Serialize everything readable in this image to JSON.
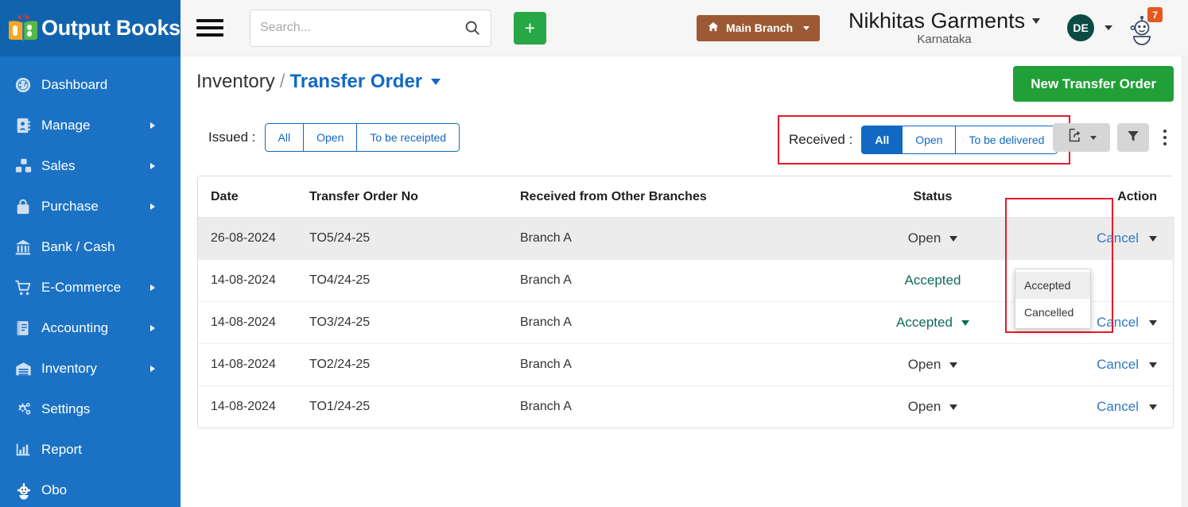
{
  "sidebar": {
    "brand": "Output Books",
    "logo_icon": "open-book-logo",
    "items": [
      {
        "label": "Dashboard",
        "icon": "dashboard-icon",
        "caret": false
      },
      {
        "label": "Manage",
        "icon": "contacts-icon",
        "caret": true
      },
      {
        "label": "Sales",
        "icon": "boxes-icon",
        "caret": true
      },
      {
        "label": "Purchase",
        "icon": "bag-icon",
        "caret": true
      },
      {
        "label": "Bank / Cash",
        "icon": "bank-icon",
        "caret": false
      },
      {
        "label": "E-Commerce",
        "icon": "cart-icon",
        "caret": true
      },
      {
        "label": "Accounting",
        "icon": "book-icon",
        "caret": true
      },
      {
        "label": "Inventory",
        "icon": "warehouse-icon",
        "caret": true
      },
      {
        "label": "Settings",
        "icon": "gears-icon",
        "caret": false
      },
      {
        "label": "Report",
        "icon": "bar-chart-icon",
        "caret": false
      },
      {
        "label": "Obo",
        "icon": "bot-icon",
        "caret": false
      }
    ]
  },
  "topbar": {
    "menu_icon": "hamburger-icon",
    "search": {
      "value": "",
      "placeholder": "Search...",
      "icon": "search-icon"
    },
    "add_button_label": "+",
    "branch": {
      "label": "Main Branch",
      "icon": "home-icon"
    },
    "company": {
      "name": "Nikhitas Garments",
      "state": "Karnataka"
    },
    "avatar": {
      "initials": "DE",
      "color": "#0b4b44"
    },
    "bot": {
      "icon": "robot-icon",
      "badge": "7",
      "badge_color": "#e8571f"
    }
  },
  "page": {
    "breadcrumb": {
      "parent": "Inventory",
      "separator": "/",
      "current": "Transfer Order"
    },
    "new_button_label": "New Transfer Order"
  },
  "filters": {
    "issued": {
      "label": "Issued :",
      "options": [
        "All",
        "Open",
        "To be receipted"
      ],
      "selected": null
    },
    "received": {
      "label": "Received :",
      "options": [
        "All",
        "Open",
        "To be delivered"
      ],
      "selected": "All",
      "highlighted": true
    },
    "tools": {
      "export_icon": "share-export-icon",
      "filter_icon": "funnel-icon",
      "more_icon": "kebab-menu-icon"
    }
  },
  "table": {
    "columns": [
      "Date",
      "Transfer Order No",
      "Received from Other Branches",
      "Status",
      "Action"
    ],
    "rows": [
      {
        "date": "26-08-2024",
        "order_no": "TO5/24-25",
        "branch": "Branch A",
        "status": "Open",
        "status_style": "default",
        "action": "Cancel",
        "highlighted": true
      },
      {
        "date": "14-08-2024",
        "order_no": "TO4/24-25",
        "branch": "Branch A",
        "status": "Accepted",
        "status_style": "accepted",
        "action": "",
        "highlighted": false
      },
      {
        "date": "14-08-2024",
        "order_no": "TO3/24-25",
        "branch": "Branch A",
        "status": "Accepted",
        "status_style": "accepted",
        "action": "Cancel",
        "highlighted": false
      },
      {
        "date": "14-08-2024",
        "order_no": "TO2/24-25",
        "branch": "Branch A",
        "status": "Open",
        "status_style": "default",
        "action": "Cancel",
        "highlighted": false
      },
      {
        "date": "14-08-2024",
        "order_no": "TO1/24-25",
        "branch": "Branch A",
        "status": "Open",
        "status_style": "default",
        "action": "Cancel",
        "highlighted": false
      }
    ]
  },
  "status_dropdown": {
    "open": true,
    "items": [
      "Accepted",
      "Cancelled"
    ],
    "hovered": "Accepted"
  },
  "annotations": {
    "color": "#e8192c",
    "boxes": [
      "received-filter-group",
      "status-column"
    ]
  }
}
